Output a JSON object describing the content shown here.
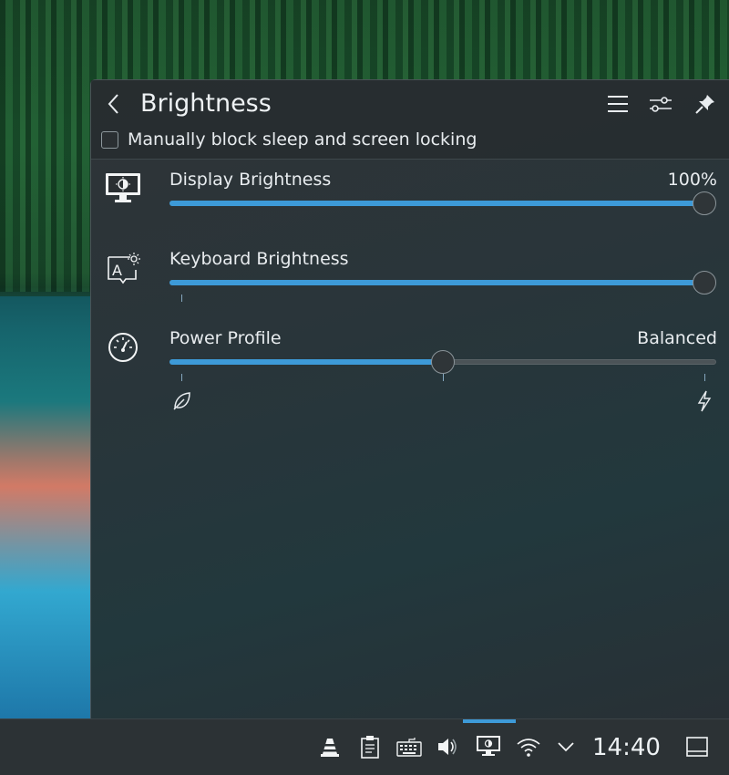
{
  "popup": {
    "title": "Brightness",
    "inhibit_label": "Manually block sleep and screen locking",
    "inhibit_checked": false
  },
  "controls": {
    "display": {
      "label": "Display Brightness",
      "value_text": "100%",
      "level": 1.0
    },
    "keyboard": {
      "label": "Keyboard Brightness",
      "value_text": "",
      "level": 1.0
    },
    "power": {
      "label": "Power Profile",
      "value_text": "Balanced",
      "level": 0.5,
      "positions": 3
    }
  },
  "taskbar": {
    "clock": "14:40",
    "tray_icons": [
      "vlc-icon",
      "clipboard-icon",
      "keyboard-layout-icon",
      "volume-icon",
      "brightness-monitor-icon",
      "wifi-icon",
      "chevron-down-icon",
      "show-desktop-icon"
    ]
  },
  "colors": {
    "accent": "#3d9ad8",
    "panel": "#2c3235"
  }
}
